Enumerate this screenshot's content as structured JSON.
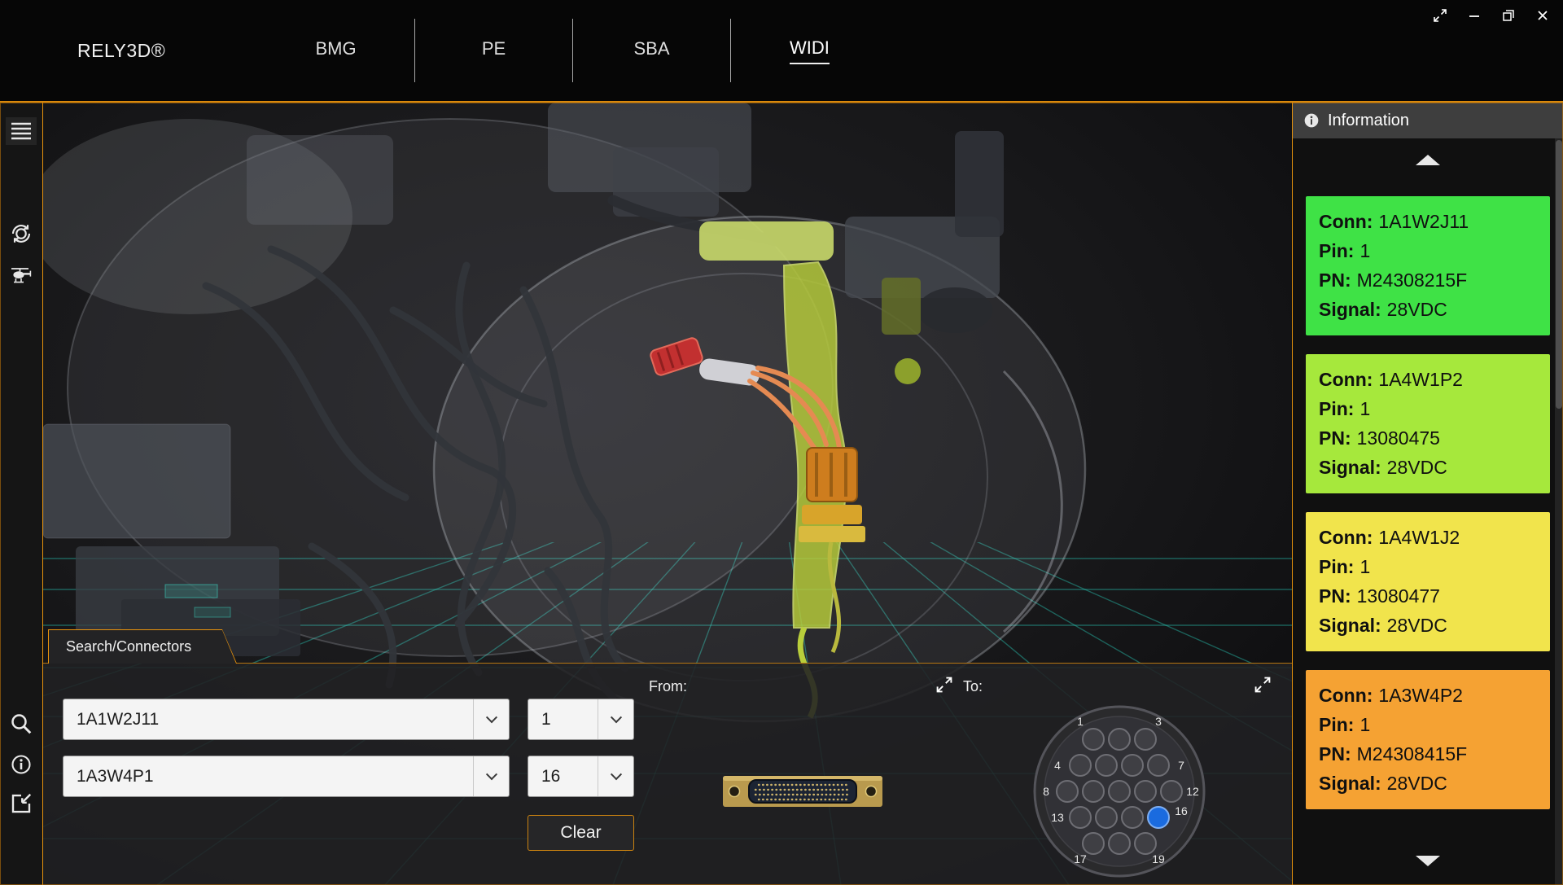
{
  "accent": "#E8930C",
  "topbar": {
    "brand": "RELY3D®",
    "tabs": [
      {
        "label": "BMG",
        "active": false
      },
      {
        "label": "PE",
        "active": false
      },
      {
        "label": "SBA",
        "active": false
      },
      {
        "label": "WIDI",
        "active": true
      }
    ]
  },
  "icons": {
    "titlebar": [
      "fullscreen-icon",
      "minimize-icon",
      "restore-icon",
      "close-icon"
    ],
    "sidebar": [
      "menu-icon",
      "orbit-rotate-icon",
      "helicopter-icon",
      "search-icon",
      "info-icon",
      "report-icon"
    ],
    "info_header": "info-circle-icon",
    "expand_buttons": "expand-arrows-icon"
  },
  "search_panel": {
    "tab_label": "Search/Connectors",
    "from_label": "From:",
    "to_label": "To:",
    "from_connector": {
      "value": "1A1W2J11",
      "pin": "1"
    },
    "to_connector": {
      "value": "1A3W4P1",
      "pin": "16"
    },
    "clear_button": "Clear",
    "to_face": {
      "pin_labels": [
        "1",
        "3",
        "4",
        "7",
        "8",
        "12",
        "13",
        "16",
        "17",
        "19"
      ],
      "selected_pin": "16",
      "selected_pin_color": "#1A6BDF"
    }
  },
  "info_panel": {
    "title": "Information",
    "field_labels": {
      "conn": "Conn:",
      "pin": "Pin:",
      "pn": "PN:",
      "signal": "Signal:"
    },
    "cards": [
      {
        "conn": "1A1W2J11",
        "pin": "1",
        "pn": "M24308215F",
        "signal": "28VDC",
        "color": "#3FE246"
      },
      {
        "conn": "1A4W1P2",
        "pin": "1",
        "pn": "13080475",
        "signal": "28VDC",
        "color": "#A6E83C"
      },
      {
        "conn": "1A4W1J2",
        "pin": "1",
        "pn": "13080477",
        "signal": "28VDC",
        "color": "#F1E44C"
      },
      {
        "conn": "1A3W4P2",
        "pin": "1",
        "pn": "M24308415F",
        "signal": "28VDC",
        "color": "#F5A233"
      }
    ]
  },
  "scene": {
    "grid_color": "#2BD8C2",
    "highlight_colors": {
      "wire": "#E58A52",
      "connector_red": "#C23030",
      "duct_green": "#B9CE3B",
      "connector_orange": "#CE7D1E"
    }
  }
}
